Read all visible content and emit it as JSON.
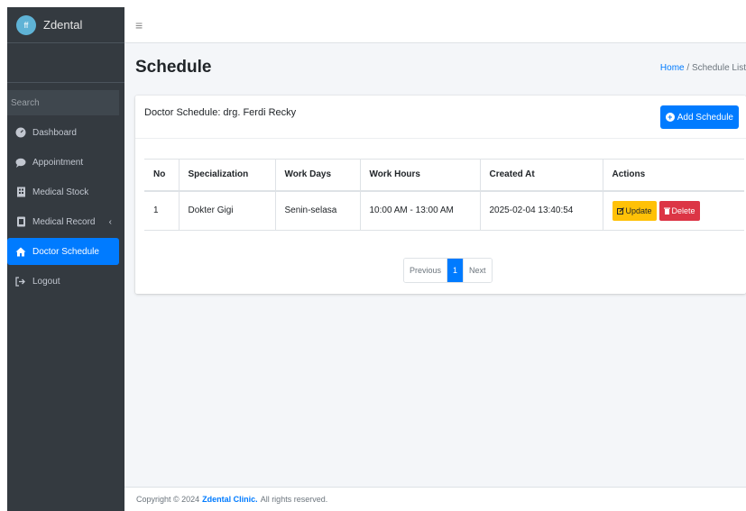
{
  "brand": {
    "logo_text": "ff",
    "name": "Zdental"
  },
  "search": {
    "placeholder": "Search"
  },
  "nav": [
    {
      "label": "Dashboard",
      "icon": "dashboard-icon"
    },
    {
      "label": "Appointment",
      "icon": "comment-icon"
    },
    {
      "label": "Medical Stock",
      "icon": "building-icon"
    },
    {
      "label": "Medical Record",
      "icon": "file-icon"
    },
    {
      "label": "Doctor Schedule",
      "icon": "home-icon"
    },
    {
      "label": "Logout",
      "icon": "logout-icon"
    }
  ],
  "header": {
    "menu_icon": "≡"
  },
  "page": {
    "title": "Schedule",
    "breadcrumb_home": "Home",
    "breadcrumb_current": "Schedule List"
  },
  "card": {
    "title": "Doctor Schedule: drg. Ferdi Recky",
    "add_label": "Add Schedule"
  },
  "table": {
    "headers": [
      "No",
      "Specialization",
      "Work Days",
      "Work Hours",
      "Created At",
      "Actions"
    ],
    "rows": [
      {
        "no": "1",
        "specialization": "Dokter Gigi",
        "work_days": "Senin-selasa",
        "work_hours": "10:00 AM - 13:00 AM",
        "created_at": "2025-02-04 13:40:54",
        "update_label": "Update",
        "delete_label": "Delete"
      }
    ]
  },
  "pagination": {
    "previous": "Previous",
    "current": "1",
    "next": "Next"
  },
  "footer": {
    "prefix": "Copyright © 2024",
    "org": "Zdental Clinic.",
    "suffix": "All rights reserved."
  },
  "colors": {
    "primary": "#007bff",
    "sidebar": "#343a40",
    "warning": "#ffc107",
    "danger": "#dc3545"
  }
}
